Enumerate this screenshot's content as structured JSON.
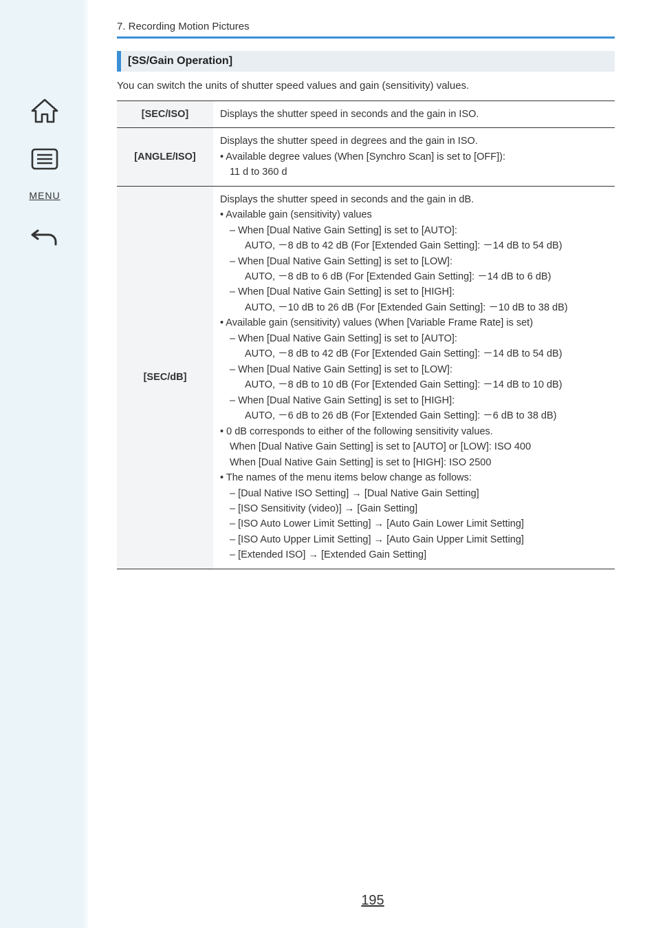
{
  "breadcrumb": "7. Recording Motion Pictures",
  "section": {
    "heading": "[SS/Gain Operation]",
    "description": "You can switch the units of shutter speed values and gain (sensitivity) values."
  },
  "table": {
    "rows": [
      {
        "label": "[SEC/ISO]",
        "lines": [
          {
            "t": "Displays the shutter speed in seconds and the gain in ISO.",
            "i": 0
          }
        ]
      },
      {
        "label": "[ANGLE/ISO]",
        "lines": [
          {
            "t": "Displays the shutter speed in degrees and the gain in ISO.",
            "i": 0
          },
          {
            "t": "• Available degree values (When [Synchro Scan] is set to [OFF]):",
            "i": 0
          },
          {
            "t": "11 d to 360 d",
            "i": 1
          }
        ]
      },
      {
        "label": "[SEC/dB]",
        "lines": [
          {
            "t": "Displays the shutter speed in seconds and the gain in dB.",
            "i": 0
          },
          {
            "t": "• Available gain (sensitivity) values",
            "i": 0
          },
          {
            "t": "– When [Dual Native Gain Setting] is set to [AUTO]:",
            "i": 1
          },
          {
            "t": "AUTO, －8 dB to 42 dB (For [Extended Gain Setting]: －14 dB to 54 dB)",
            "i": 2
          },
          {
            "t": "– When [Dual Native Gain Setting] is set to [LOW]:",
            "i": 1
          },
          {
            "t": "AUTO, －8 dB to 6 dB (For [Extended Gain Setting]: －14 dB to 6 dB)",
            "i": 2
          },
          {
            "t": "– When [Dual Native Gain Setting] is set to [HIGH]:",
            "i": 1
          },
          {
            "t": "AUTO, －10 dB to 26 dB (For [Extended Gain Setting]: －10 dB to 38 dB)",
            "i": 2
          },
          {
            "t": "• Available gain (sensitivity) values (When [Variable Frame Rate] is set)",
            "i": 0
          },
          {
            "t": "– When [Dual Native Gain Setting] is set to [AUTO]:",
            "i": 1
          },
          {
            "t": "AUTO, －8 dB to 42 dB (For [Extended Gain Setting]: －14 dB to 54 dB)",
            "i": 2
          },
          {
            "t": "– When [Dual Native Gain Setting] is set to [LOW]:",
            "i": 1
          },
          {
            "t": "AUTO, －8 dB to 10 dB (For [Extended Gain Setting]: －14 dB to 10 dB)",
            "i": 2
          },
          {
            "t": "– When [Dual Native Gain Setting] is set to [HIGH]:",
            "i": 1
          },
          {
            "t": "AUTO, －6 dB to 26 dB (For [Extended Gain Setting]: －6 dB to 38 dB)",
            "i": 2
          },
          {
            "t": "• 0 dB corresponds to either of the following sensitivity values.",
            "i": 0
          },
          {
            "t": "When [Dual Native Gain Setting] is set to [AUTO] or [LOW]: ISO 400",
            "i": 1
          },
          {
            "t": "When [Dual Native Gain Setting] is set to [HIGH]: ISO 2500",
            "i": 1
          },
          {
            "t": "• The names of the menu items below change as follows:",
            "i": 0
          },
          {
            "t": "– [Dual Native ISO Setting] → [Dual Native Gain Setting]",
            "i": 1
          },
          {
            "t": "– [ISO Sensitivity (video)] → [Gain Setting]",
            "i": 1
          },
          {
            "t": "– [ISO Auto Lower Limit Setting] → [Auto Gain Lower Limit Setting]",
            "i": 1
          },
          {
            "t": "– [ISO Auto Upper Limit Setting] → [Auto Gain Upper Limit Setting]",
            "i": 1
          },
          {
            "t": "– [Extended ISO] → [Extended Gain Setting]",
            "i": 1
          }
        ]
      }
    ]
  },
  "nav": {
    "menu_label": "MENU"
  },
  "page_number": "195"
}
